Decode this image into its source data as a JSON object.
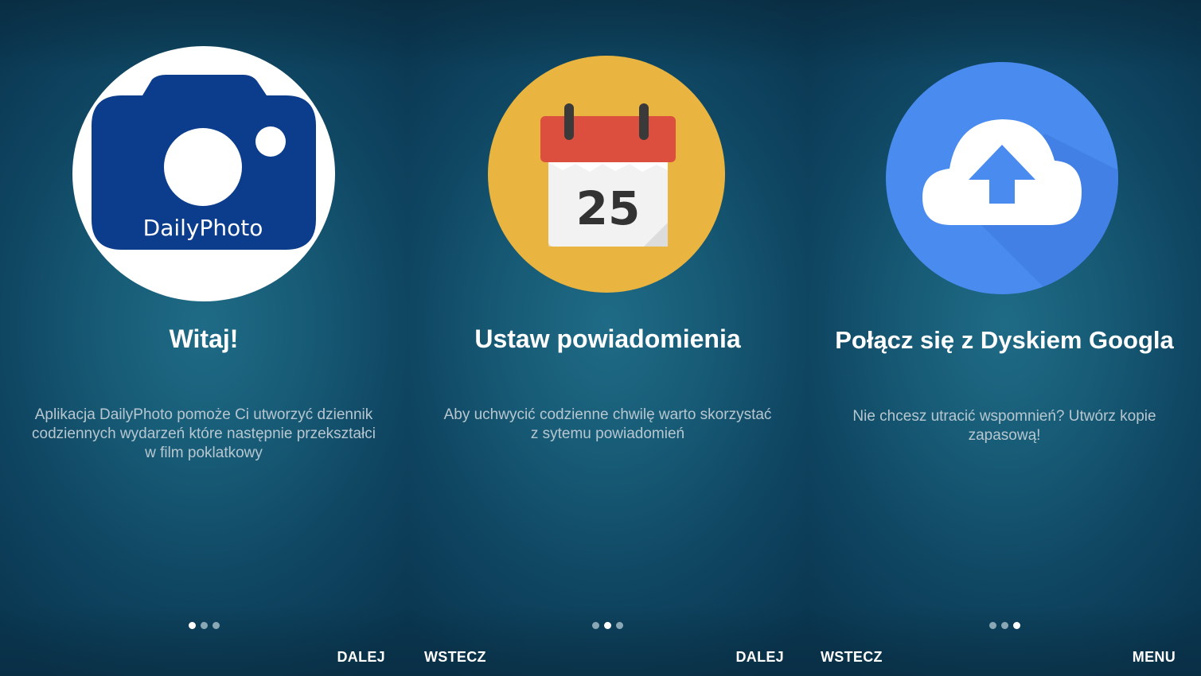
{
  "screens": [
    {
      "logo_text": "DailyPhoto",
      "title": "Witaj!",
      "description": "Aplikacja DailyPhoto pomoże Ci utworzyć dziennik codziennych wydarzeń które następnie przekształci w film poklatkowy",
      "active_page": 1,
      "right_button": "DALEJ",
      "icon": "camera-icon"
    },
    {
      "calendar_day": "25",
      "title": "Ustaw powiadomienia",
      "description": "Aby uchwycić codzienne chwilę warto skorzystać z sytemu powiadomień",
      "active_page": 2,
      "left_button": "WSTECZ",
      "right_button": "DALEJ",
      "icon": "calendar-icon"
    },
    {
      "title": "Połącz się z Dyskiem Googla",
      "description": "Nie chcesz utracić wspomnień? Utwórz kopie zapasową!",
      "active_page": 3,
      "left_button": "WSTECZ",
      "right_button": "MENU",
      "icon": "cloud-upload-icon"
    }
  ],
  "total_pages": 3,
  "colors": {
    "background": "#175a75",
    "camera_blue": "#0b3d8c",
    "calendar_yellow": "#e9b43f",
    "calendar_red": "#dc4f3e",
    "cloud_blue": "#4a8bf0"
  }
}
